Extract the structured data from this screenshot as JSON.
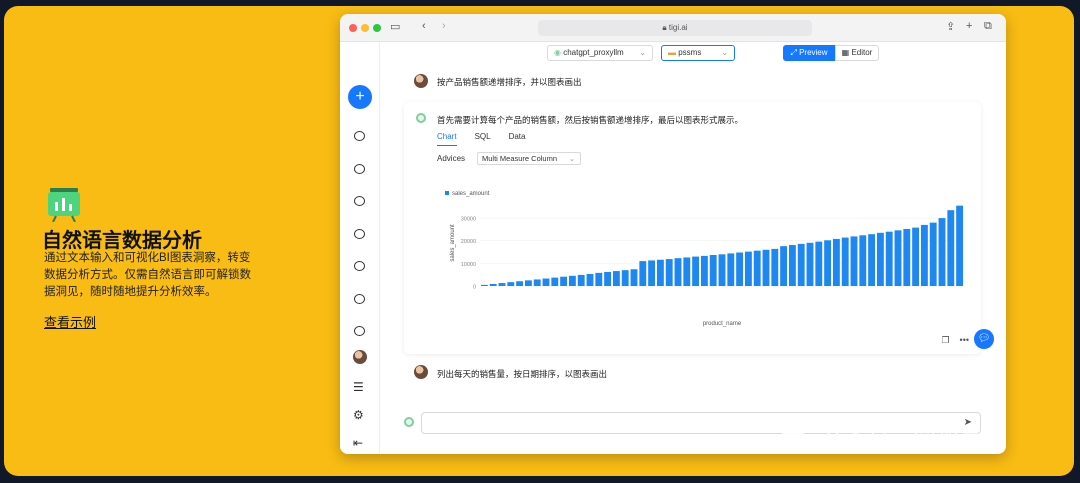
{
  "promo": {
    "title": "自然语言数据分析",
    "description": "通过文本输入和可视化BI图表洞察，转变数据分析方式。仅需自然语言即可解锁数据洞见，随时随地提升分析效率。",
    "link": "查看示例"
  },
  "watermark": {
    "text": "公众号 · 赛那云"
  },
  "browser": {
    "url": "tigi.ai"
  },
  "toolbar": {
    "model_select": "chatgpt_proxyllm",
    "db_select": "pssms",
    "preview_label": "Preview",
    "editor_label": "Editor"
  },
  "conversation": {
    "user_question_1": "按产品销售额递增排序，并以图表画出",
    "assistant_reply_1": "首先需要计算每个产品的销售额，然后按销售额递增排序，最后以图表形式展示。",
    "user_question_2": "列出每天的销售量，按日期排序，以图表画出"
  },
  "result_tabs": [
    "Chart",
    "SQL",
    "Data"
  ],
  "advices": {
    "label": "Advices",
    "selected": "Multi Measure Column"
  },
  "colors": {
    "accent": "#1677ff",
    "bar": "#1e88f0",
    "background": "#f9bc14"
  },
  "chart_data": {
    "type": "bar",
    "legend": [
      "sales_amount"
    ],
    "legend_position": "top-left",
    "xlabel": "product_name",
    "ylabel": "sales_amount",
    "yticks": [
      0,
      10000,
      20000,
      30000
    ],
    "ylim": [
      0,
      38000
    ],
    "grid": true,
    "values": [
      500,
      900,
      1300,
      1700,
      2100,
      2500,
      2900,
      3300,
      3700,
      4100,
      4500,
      4900,
      5300,
      5800,
      6200,
      6600,
      7000,
      7400,
      11000,
      11300,
      11600,
      11900,
      12300,
      12600,
      13000,
      13300,
      13700,
      14000,
      14400,
      14800,
      15200,
      15600,
      16000,
      16400,
      17600,
      18100,
      18600,
      19100,
      19600,
      20200,
      20800,
      21400,
      21900,
      22400,
      22900,
      23500,
      24000,
      24600,
      25200,
      25800,
      27000,
      28000,
      30000,
      33500,
      35500
    ]
  }
}
